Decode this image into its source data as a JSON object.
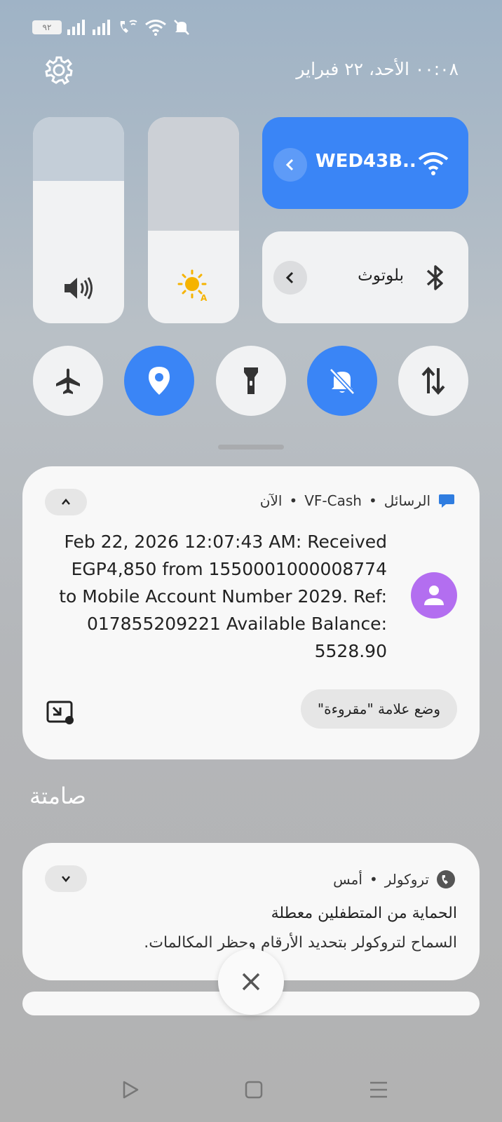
{
  "status_bar": {
    "battery": "٩٢"
  },
  "header": {
    "datetime": "٠٠:٠٨ الأحد، ٢٢ فبراير"
  },
  "wifi": {
    "network_name": "WED43B.."
  },
  "bluetooth": {
    "label": "بلوتوث"
  },
  "levels": {
    "volume_fraction": 0.69,
    "brightness_fraction": 0.45
  },
  "toggles": [
    {
      "name": "airplane",
      "on": false
    },
    {
      "name": "location",
      "on": true
    },
    {
      "name": "flashlight",
      "on": false
    },
    {
      "name": "silent",
      "on": true
    },
    {
      "name": "mobile-data",
      "on": false
    }
  ],
  "notification_1": {
    "app": "الرسائل",
    "sender": "VF-Cash",
    "time": "الآن",
    "body_lines": [
      "Feb 22, 2026 12:07:43 AM: Received",
      "EGP4,850 from 1550001000008774",
      "to Mobile Account Number 2029. Ref:",
      "017855209221 Available Balance:",
      "5528.90"
    ],
    "action": "وضع علامة \"مقروءة\""
  },
  "section_silent": "صامتة",
  "notification_2": {
    "app": "تروكولر",
    "time": "أمس",
    "title": "الحماية من المتطفلين معطلة",
    "text": "السماح لتروكولر بتحديد الأرقام وحظر المكالمات."
  },
  "colors": {
    "accent": "#3a85f6",
    "avatar": "#b36ef0"
  }
}
